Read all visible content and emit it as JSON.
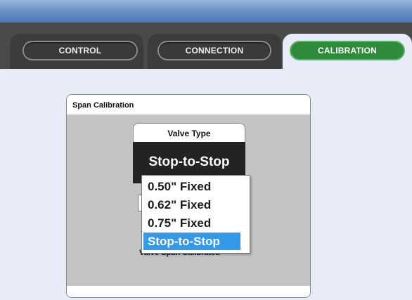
{
  "tabs": [
    {
      "label": "CONTROL",
      "active": false
    },
    {
      "label": "CONNECTION",
      "active": false
    },
    {
      "label": "CALIBRATION",
      "active": true
    }
  ],
  "panel": {
    "title": "Span Calibration",
    "valve_type": {
      "label": "Valve Type",
      "selected": "Stop-to-Stop"
    },
    "dropdown_options": [
      "0.50\" Fixed",
      "0.62\" Fixed",
      "0.75\" Fixed",
      "Stop-to-Stop"
    ],
    "highlighted_option": "Stop-to-Stop",
    "status": "Valve Span Calibrated"
  },
  "colors": {
    "active_tab": "#2f8a3c",
    "highlight": "#3399ea",
    "title_bar": "#6a93c6"
  }
}
